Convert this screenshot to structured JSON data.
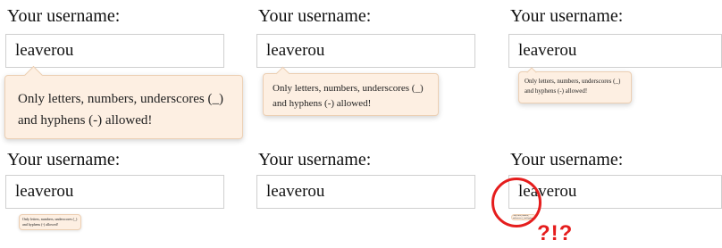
{
  "label": "Your username:",
  "value": "leaverou",
  "tooltip": "Only letters, numbers, underscores (_) and hyphens (-) allowed!",
  "annotation": "?!?",
  "colors": {
    "tooltip_bg": "#fdefe2",
    "tooltip_border": "#eccfb3",
    "annotation_red": "#e51d1d"
  }
}
